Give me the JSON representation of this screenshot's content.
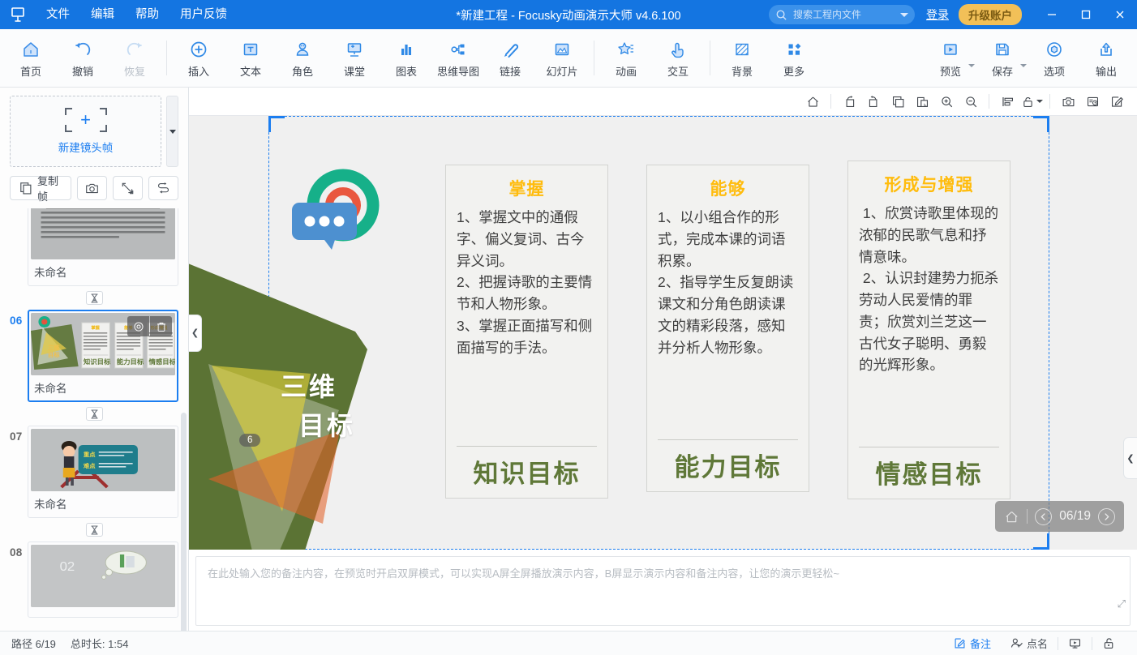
{
  "titlebar": {
    "menu": [
      "文件",
      "编辑",
      "帮助",
      "用户反馈"
    ],
    "title": "*新建工程 - Focusky动画演示大师  v4.6.100",
    "search_placeholder": "搜索工程内文件",
    "search_value": "",
    "login_label": "登录",
    "upgrade_label": "升级账户",
    "minimize": "—",
    "maximize": "▢",
    "close": "✕"
  },
  "ribbon": {
    "groups": [
      {
        "items": [
          {
            "label": "首页",
            "icon": "home-icon",
            "disabled": false
          },
          {
            "label": "撤销",
            "icon": "undo-icon",
            "disabled": false
          },
          {
            "label": "恢复",
            "icon": "redo-icon",
            "disabled": true
          }
        ]
      },
      {
        "items": [
          {
            "label": "插入",
            "icon": "plus-circle-icon",
            "disabled": false
          },
          {
            "label": "文本",
            "icon": "text-box-icon",
            "disabled": false
          },
          {
            "label": "角色",
            "icon": "character-icon",
            "disabled": false
          },
          {
            "label": "课堂",
            "icon": "classroom-icon",
            "disabled": false
          },
          {
            "label": "图表",
            "icon": "bar-chart-icon",
            "disabled": false
          },
          {
            "label": "思维导图",
            "icon": "mindmap-icon",
            "disabled": false
          },
          {
            "label": "链接",
            "icon": "link-icon",
            "disabled": false
          },
          {
            "label": "幻灯片",
            "icon": "slide-icon",
            "disabled": false
          }
        ]
      },
      {
        "items": [
          {
            "label": "动画",
            "icon": "star-animation-icon",
            "disabled": false
          },
          {
            "label": "交互",
            "icon": "hand-click-icon",
            "disabled": false
          }
        ]
      },
      {
        "items": [
          {
            "label": "背景",
            "icon": "background-icon",
            "disabled": false
          },
          {
            "label": "更多",
            "icon": "grid-more-icon",
            "disabled": false
          }
        ]
      },
      {
        "items": [
          {
            "label": "预览",
            "icon": "play-preview-icon",
            "dropdown": true,
            "disabled": false
          },
          {
            "label": "保存",
            "icon": "save-disk-icon",
            "dropdown": true,
            "disabled": false
          },
          {
            "label": "选项",
            "icon": "gear-options-icon",
            "disabled": false
          },
          {
            "label": "输出",
            "icon": "upload-export-icon",
            "disabled": false
          }
        ]
      }
    ]
  },
  "slide_panel": {
    "new_frame_label": "新建镜头帧",
    "tools": [
      {
        "label": "复制帧",
        "icon": "copy-frame-icon"
      },
      {
        "label": "",
        "icon": "camera-icon"
      },
      {
        "label": "",
        "icon": "fit-frame-icon"
      },
      {
        "label": "",
        "icon": "path-order-icon"
      }
    ],
    "thumbs": [
      {
        "number": "",
        "name": "未命名",
        "selected": false,
        "kind": "text-page"
      },
      {
        "number": "06",
        "name": "未命名",
        "selected": true,
        "kind": "goals-page"
      },
      {
        "number": "07",
        "name": "未命名",
        "selected": false,
        "kind": "character-board"
      },
      {
        "number": "08",
        "name": "",
        "selected": false,
        "kind": "chapter-02"
      }
    ],
    "thumb_actions": [
      "settings-icon",
      "delete-icon"
    ]
  },
  "canvas_toolbar": {
    "buttons": [
      "home-icon",
      "rotate-left-icon",
      "rotate-right-icon",
      "duplicate-icon",
      "paste-icon",
      "zoom-in-icon",
      "zoom-out-icon",
      "align-icon",
      "lock-icon",
      "camera-capture-icon",
      "frame-history-icon",
      "edit-note-icon"
    ]
  },
  "slide": {
    "badge": "6",
    "title_line1": "三维",
    "title_line2": "目标",
    "cards": [
      {
        "head": "掌握",
        "body": "1、掌握文中的通假字、偏义复词、古今异义词。\n2、把握诗歌的主要情节和人物形象。\n3、掌握正面描写和侧面描写的手法。",
        "foot": "知识目标"
      },
      {
        "head": "能够",
        "body": "1、以小组合作的形式，完成本课的词语积累。\n2、指导学生反复朗读课文和分角色朗读课文的精彩段落，感知并分析人物形象。",
        "foot": "能力目标"
      },
      {
        "head": "形成与增强",
        "body": " 1、欣赏诗歌里体现的浓郁的民歌气息和抒情意味。\n 2、认识封建势力扼杀劳动人民爱情的罪责；欣赏刘兰芝这一古代女子聪明、勇毅的光辉形象。",
        "foot": "情感目标"
      }
    ],
    "nav_overlay": {
      "page": "06/19",
      "home_icon": "home-icon",
      "prev_icon": "prev-icon",
      "next_icon": "next-icon"
    }
  },
  "notes": {
    "placeholder": "在此处输入您的备注内容，在预览时开启双屏模式，可以实现A屏全屏播放演示内容，B屏显示演示内容和备注内容，让您的演示更轻松~",
    "value": ""
  },
  "statusbar": {
    "path_label": "路径 6/19",
    "duration_label": "总时长: 1:54",
    "buttons": [
      {
        "label": "备注",
        "icon": "note-edit-icon",
        "accent": true
      },
      {
        "label": "点名",
        "icon": "roll-call-icon",
        "accent": false
      },
      {
        "label": "",
        "icon": "presenter-screen-icon",
        "accent": false
      },
      {
        "label": "",
        "icon": "unlock-icon",
        "accent": false
      }
    ]
  },
  "colors": {
    "brand_blue": "#1475e1",
    "accent_blue": "#1c7ef0",
    "upgrade_gold": "#f2c058",
    "card_head": "#ffbc0d",
    "card_foot_green": "#5f7838",
    "shape_green": "#5b7334"
  }
}
